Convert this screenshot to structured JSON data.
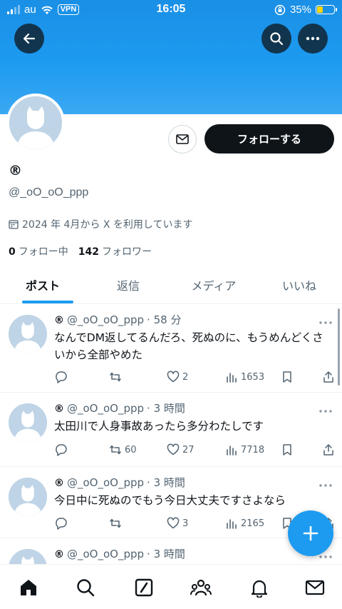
{
  "status_bar": {
    "carrier": "au",
    "vpn": "VPN",
    "time": "16:05",
    "battery": "35%",
    "battery_level": 0.35
  },
  "profile": {
    "name": "®",
    "handle": "@_oO_oO_ppp",
    "joined": "2024 年 4月から X を利用しています",
    "following_count": "0",
    "following_label": "フォロー中",
    "followers_count": "142",
    "followers_label": "フォロワー",
    "follow_button": "フォローする"
  },
  "tabs": [
    {
      "label": "ポスト",
      "active": true
    },
    {
      "label": "返信",
      "active": false
    },
    {
      "label": "メディア",
      "active": false
    },
    {
      "label": "いいね",
      "active": false
    }
  ],
  "posts": [
    {
      "name": "®",
      "handle": "@_oO_oO_ppp",
      "time": "· 58 分",
      "text": "なんでDM返してるんだろ、死ぬのに、もうめんどくさいから全部やめた",
      "replies": "",
      "reposts": "",
      "likes": "2",
      "views": "1653"
    },
    {
      "name": "®",
      "handle": "@_oO_oO_ppp",
      "time": "· 3 時間",
      "text": "太田川で人身事故あったら多分わたしです",
      "replies": "",
      "reposts": "60",
      "likes": "27",
      "views": "7718"
    },
    {
      "name": "®",
      "handle": "@_oO_oO_ppp",
      "time": "· 3 時間",
      "text": "今日中に死ぬのでもう今日大丈夫ですさよなら",
      "replies": "",
      "reposts": "",
      "likes": "3",
      "views": "2165"
    },
    {
      "name": "®",
      "handle": "@_oO_oO_ppp",
      "time": "· 3 時間",
      "text": "",
      "replies": "",
      "reposts": "",
      "likes": "",
      "views": ""
    }
  ],
  "icons": {
    "back": "arrow-left-icon",
    "search": "search-icon",
    "more": "more-icon",
    "mail": "mail-icon",
    "compose": "plus-icon",
    "nav": [
      "home-icon",
      "search-icon",
      "grok-icon",
      "communities-icon",
      "notifications-icon",
      "messages-icon"
    ]
  },
  "colors": {
    "accent": "#1d9bf0",
    "text": "#0f1419",
    "muted": "#536471",
    "banner": "#1d9bf0"
  }
}
